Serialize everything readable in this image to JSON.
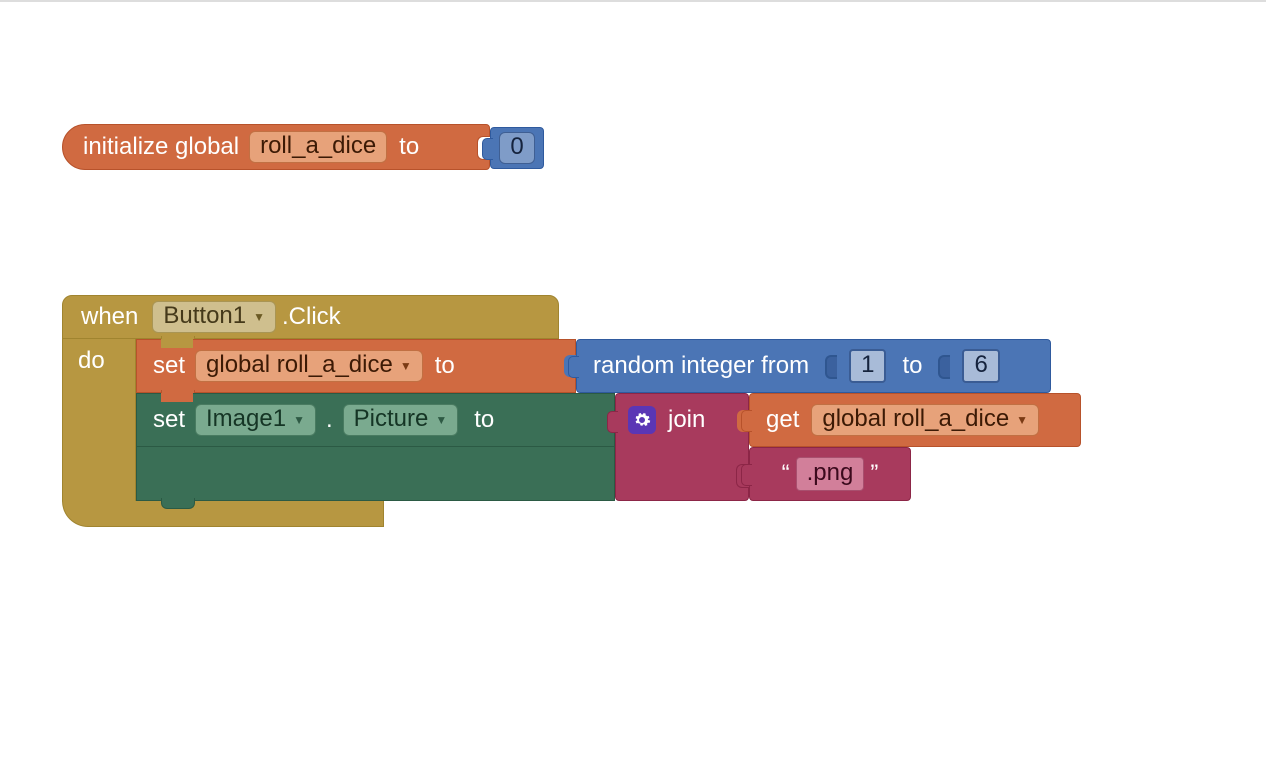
{
  "init_block": {
    "prefix": "initialize global",
    "var_name": "roll_a_dice",
    "to": "to",
    "value": "0"
  },
  "event_block": {
    "when": "when",
    "component": "Button1",
    "event_suffix": ".Click",
    "do": "do"
  },
  "set_global": {
    "set": "set",
    "var_ref": "global roll_a_dice",
    "to": "to"
  },
  "random": {
    "label_from": "random integer from",
    "from_value": "1",
    "label_to": "to",
    "to_value": "6"
  },
  "set_prop": {
    "set": "set",
    "component": "Image1",
    "dot": ".",
    "property": "Picture",
    "to": "to"
  },
  "join": {
    "label": "join"
  },
  "get": {
    "label": "get",
    "var_ref": "global roll_a_dice"
  },
  "string_literal": {
    "open_quote": "“",
    "value": ".png",
    "close_quote": "”"
  }
}
